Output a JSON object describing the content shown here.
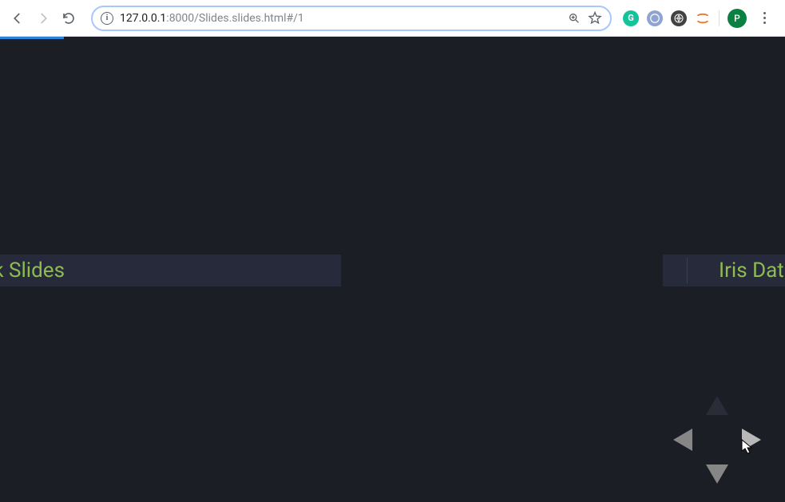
{
  "browser": {
    "url_info_label": "i",
    "url_host": "127.0.0.1",
    "url_port_path": ":8000/Slides.slides.html#/1",
    "avatar_initial": "P"
  },
  "slides": {
    "left_peek_text": "k Slides",
    "right_peek_text": "Iris Data"
  }
}
